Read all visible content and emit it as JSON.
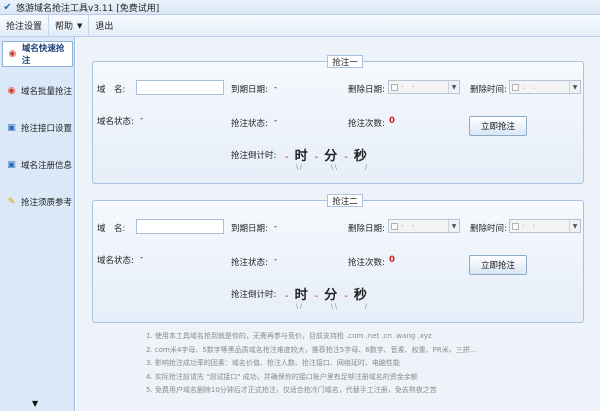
{
  "window": {
    "title": "悠游域名抢注工具v3.11 [免费试用]",
    "logo_icon": "wing-logo-icon"
  },
  "menu": {
    "items": [
      {
        "label": "抢注设置"
      },
      {
        "label": "帮助",
        "has_dropdown": true
      },
      {
        "label": "退出"
      }
    ]
  },
  "sidebar": {
    "items": [
      {
        "label": "域名快速抢注",
        "icon": "target-icon",
        "active": true
      },
      {
        "label": "域名批量抢注",
        "icon": "target-icon",
        "active": false
      },
      {
        "label": "抢注接口设置",
        "icon": "window-icon",
        "active": false
      },
      {
        "label": "域名注册信息",
        "icon": "window-icon",
        "active": false
      },
      {
        "label": "抢注须质参考",
        "icon": "pin-icon",
        "active": false
      }
    ],
    "scroll_down": "▼"
  },
  "panels": [
    {
      "title": "抢注一",
      "domain_label": "域　名:",
      "domain_value": "",
      "expire_label": "到期日期:",
      "expire_value": "-",
      "delete_date_label": "删除日期:",
      "delete_time_label": "删除时间:",
      "delete_date_value": "-  -",
      "delete_time_value": ": :",
      "status_label": "域名状态:",
      "status_value": "-",
      "reg_status_label": "抢注状态:",
      "reg_status_value": "-",
      "count_label": "抢注次数:",
      "count_value": "0",
      "button_label": "立即抢注",
      "countdown_label": "抢注倒计时:",
      "dash": "-",
      "hour": "时",
      "minute": "分",
      "second": "秒",
      "sub_labels": [
        "\\ /",
        "\\ \\",
        "/"
      ]
    },
    {
      "title": "抢注二",
      "domain_label": "域　名:",
      "domain_value": "",
      "expire_label": "到期日期:",
      "expire_value": "-",
      "delete_date_label": "删除日期:",
      "delete_time_label": "删除时间:",
      "delete_date_value": "-  -",
      "delete_time_value": ": :",
      "status_label": "域名状态:",
      "status_value": "-",
      "reg_status_label": "抢注状态:",
      "reg_status_value": "-",
      "count_label": "抢注次数:",
      "count_value": "0",
      "button_label": "立即抢注",
      "countdown_label": "抢注倒计时:",
      "dash": "-",
      "hour": "时",
      "minute": "分",
      "second": "秒",
      "sub_labels": [
        "\\ /",
        "\\ \\",
        "/"
      ]
    }
  ],
  "notes": [
    "1.  使用本工具域名抢到就是你的，无需再参与竞价，目前支持抢 .com .net .cn .wang .xyz",
    "2.  com米4字母、5数字等黑品质域名抢注难度较大，推荐抢注5字母、6数字、音素、权重、PR米、三拼...",
    "3.  影响抢注成功率的因素：域名价值、抢注人数、抢注接口、网络延时、电脑性能",
    "4.  实际抢注前请先 \"测试接口\" 成功，并确保你的接口账户里有足够注册域名的资金余额",
    "5.  免费用户域名删除10分钟后才正式抢注，仅适合抢冷门域名，代替手工注册，免去熬夜之苦"
  ]
}
